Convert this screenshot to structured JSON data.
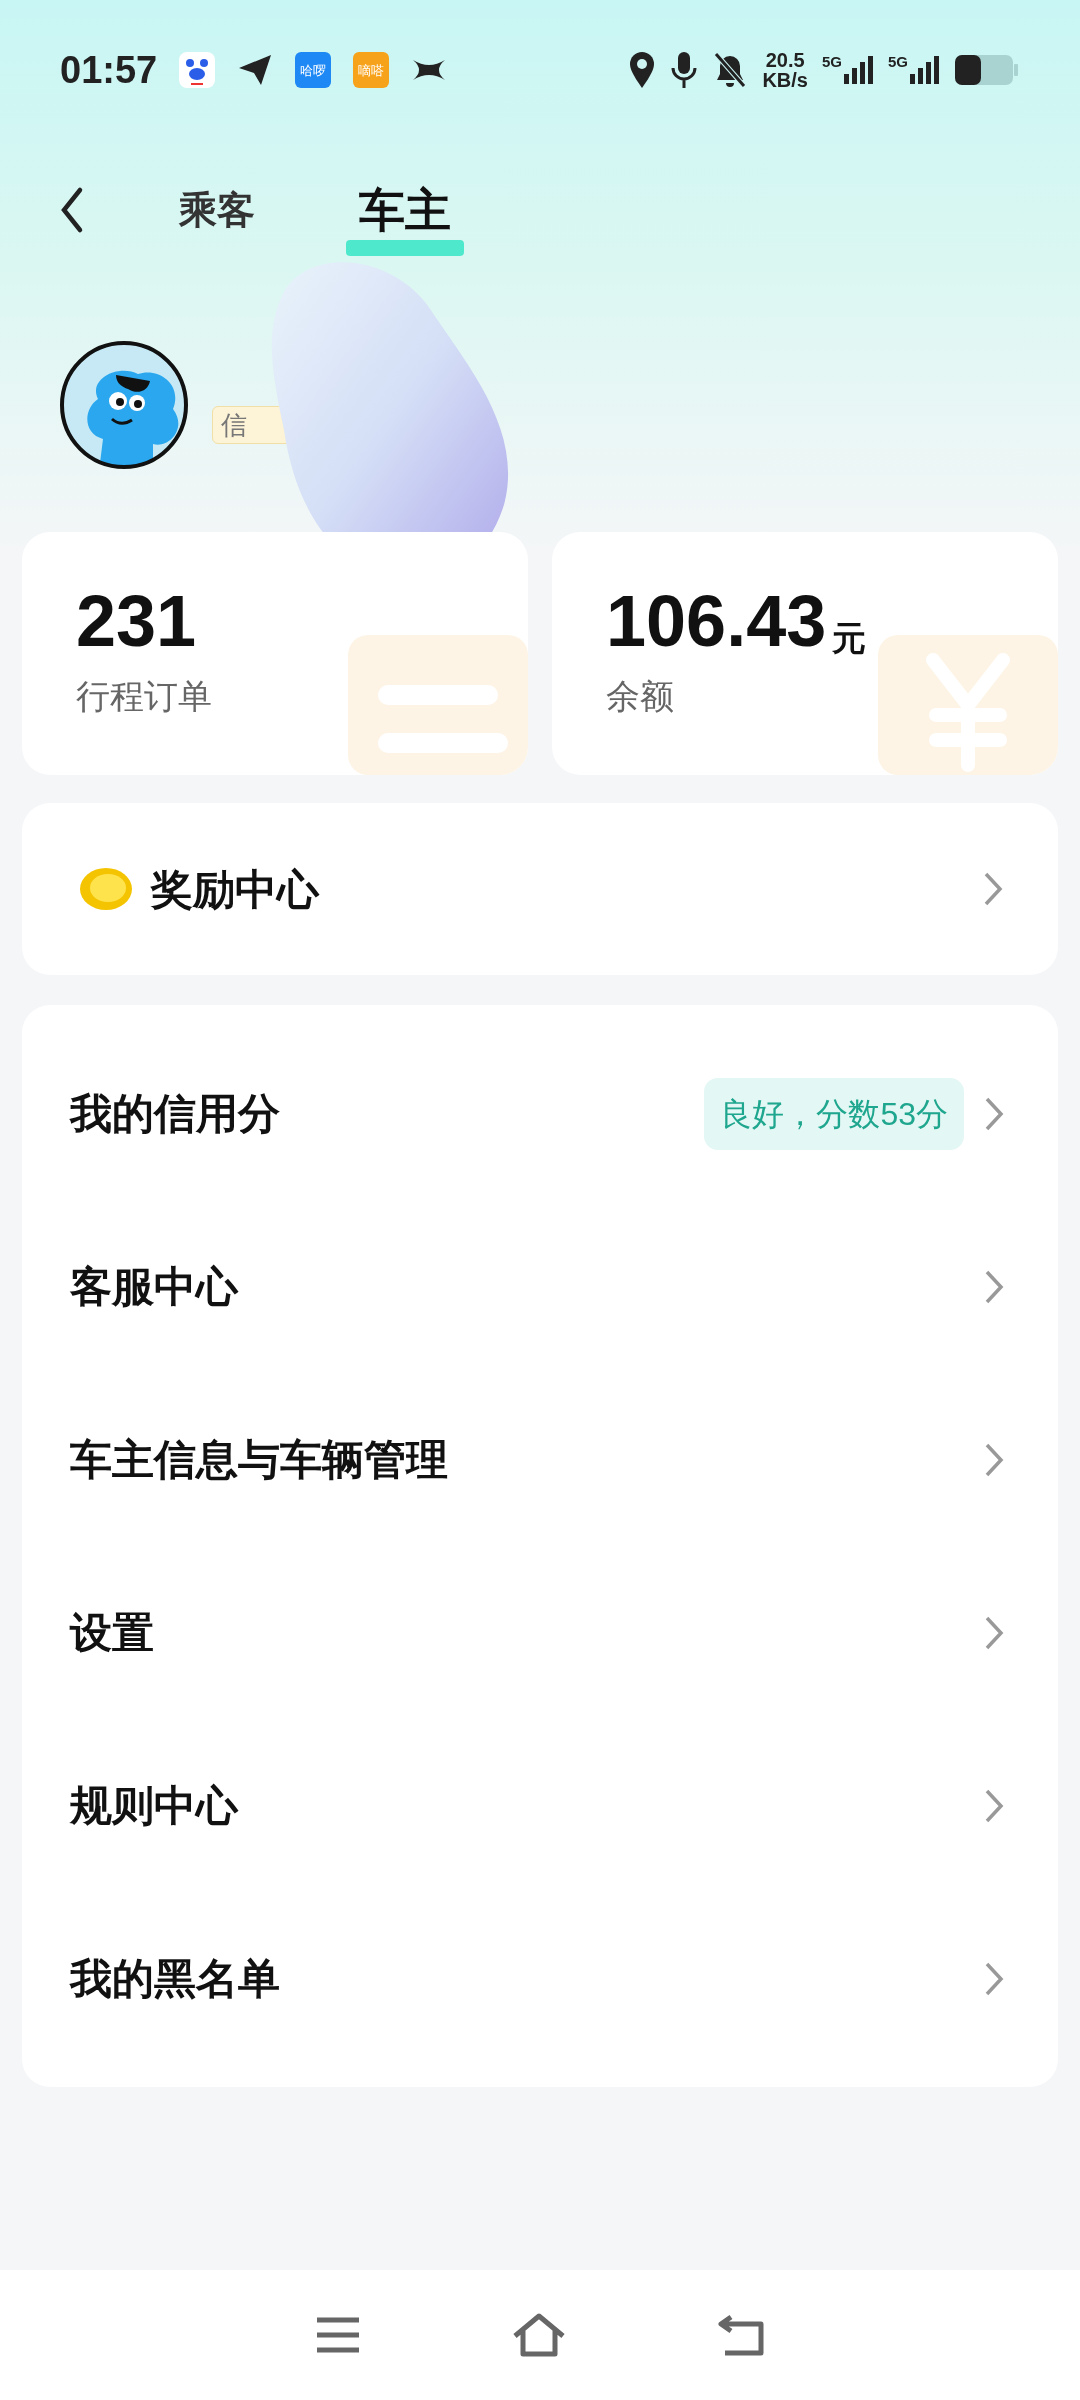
{
  "status_bar": {
    "time": "01:57",
    "app_icons": [
      {
        "kind": "paw"
      },
      {
        "kind": "plane"
      },
      {
        "kind": "text",
        "label": "哈啰",
        "color": "#1e88f5"
      },
      {
        "kind": "text",
        "label": "嘀嗒",
        "color": "#f7a21b"
      },
      {
        "kind": "x"
      }
    ],
    "speed": "20.5",
    "speed_unit": "KB/s",
    "network_1": "5G",
    "network_2": "5G"
  },
  "tabs": [
    {
      "label": "乘客",
      "selected": false
    },
    {
      "label": "车主",
      "selected": true
    }
  ],
  "profile": {
    "badge": "信"
  },
  "stats": [
    {
      "kind": "orders",
      "value": "231",
      "label": "行程订单"
    },
    {
      "kind": "balance",
      "value": "106.43",
      "unit": "元",
      "label": "余额"
    }
  ],
  "rewards": {
    "label": "奖励中心"
  },
  "menu": [
    {
      "label": "我的信用分",
      "tag": "良好，分数53分"
    },
    {
      "label": "客服中心"
    },
    {
      "label": "车主信息与车辆管理"
    },
    {
      "label": "设置"
    },
    {
      "label": "规则中心"
    },
    {
      "label": "我的黑名单"
    }
  ]
}
